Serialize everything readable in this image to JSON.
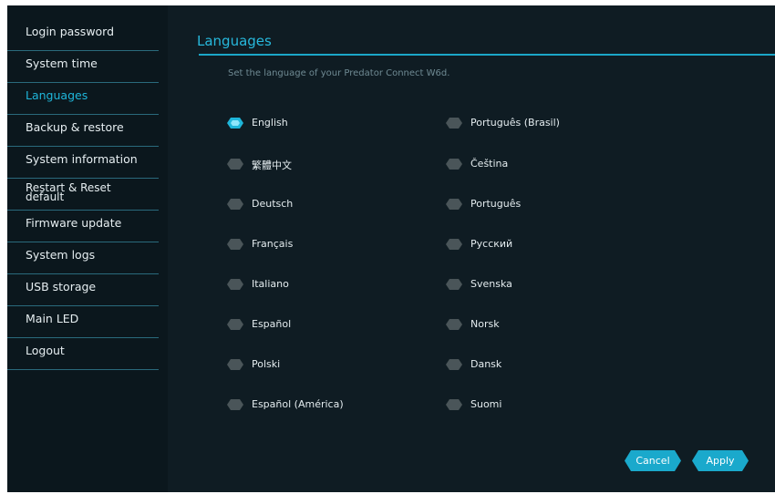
{
  "sidebar": {
    "items": [
      {
        "label": "Login password"
      },
      {
        "label": "System time"
      },
      {
        "label": "Languages",
        "active": true
      },
      {
        "label": "Backup & restore"
      },
      {
        "label": "System information"
      },
      {
        "label": "Restart & Reset default"
      },
      {
        "label": "Firmware update"
      },
      {
        "label": "System logs"
      },
      {
        "label": "USB storage"
      },
      {
        "label": "Main LED"
      },
      {
        "label": "Logout"
      }
    ]
  },
  "main": {
    "title": "Languages",
    "subtitle": "Set the language of your Predator Connect W6d.",
    "languages": [
      {
        "label": "English",
        "selected": true
      },
      {
        "label": "Português (Brasil)",
        "selected": false
      },
      {
        "label": "繁體中文",
        "selected": false
      },
      {
        "label": "Čeština",
        "selected": false
      },
      {
        "label": "Deutsch",
        "selected": false
      },
      {
        "label": "Português",
        "selected": false
      },
      {
        "label": "Français",
        "selected": false
      },
      {
        "label": "Русский",
        "selected": false
      },
      {
        "label": "Italiano",
        "selected": false
      },
      {
        "label": "Svenska",
        "selected": false
      },
      {
        "label": "Español",
        "selected": false
      },
      {
        "label": "Norsk",
        "selected": false
      },
      {
        "label": "Polski",
        "selected": false
      },
      {
        "label": "Dansk",
        "selected": false
      },
      {
        "label": "Español (América)",
        "selected": false
      },
      {
        "label": "Suomi",
        "selected": false
      }
    ],
    "cancel_label": "Cancel",
    "apply_label": "Apply"
  },
  "colors": {
    "accent": "#1fb6da",
    "background": "#0f1c23",
    "sidebar": "#0b171d",
    "radio_off": "#4a5559"
  }
}
